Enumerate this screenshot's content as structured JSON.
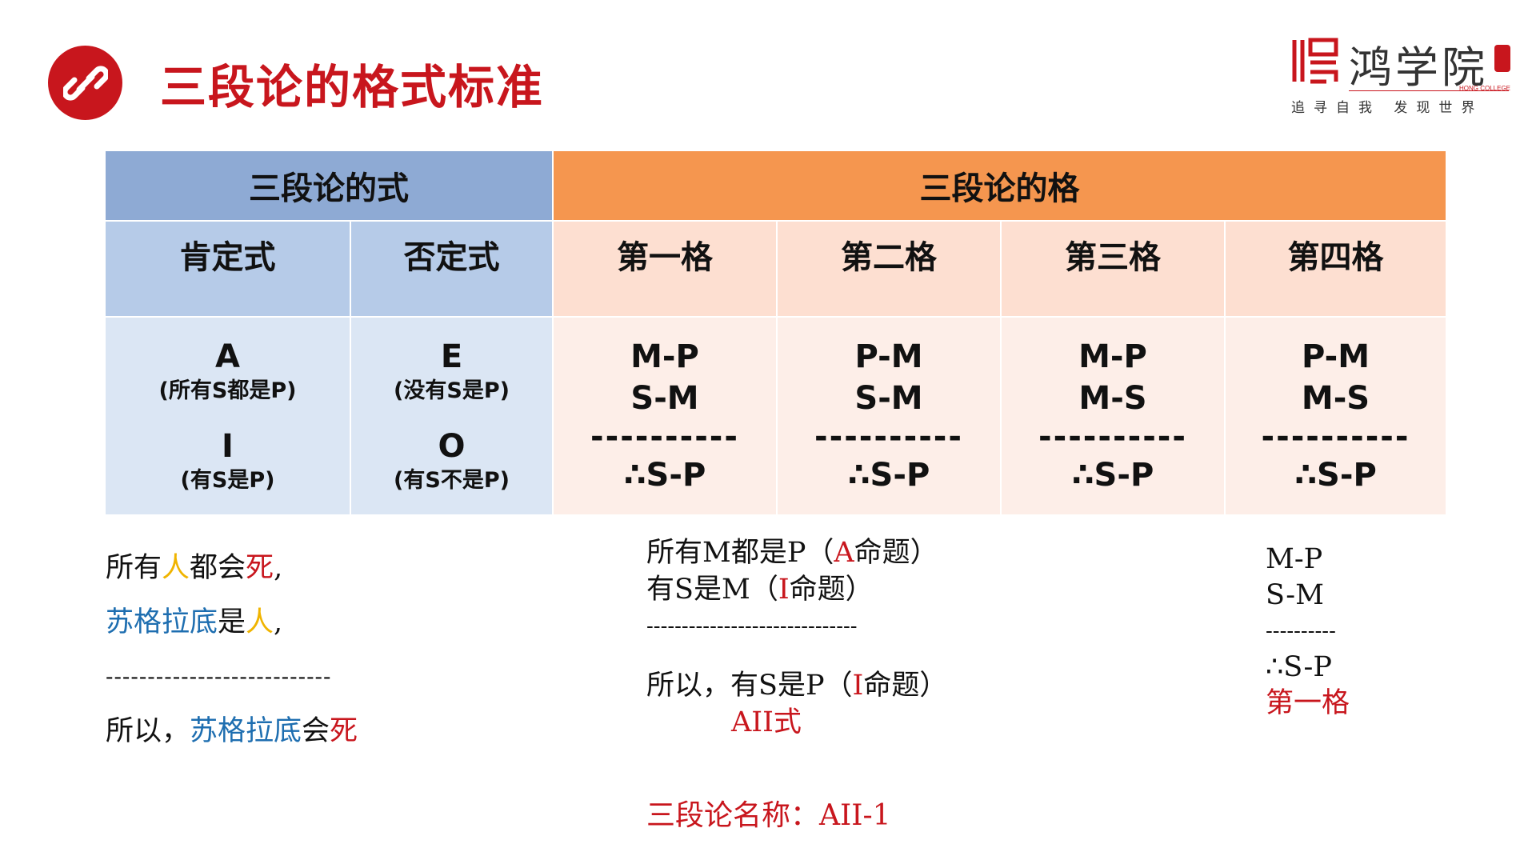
{
  "header": {
    "title": "三段论的格式标准",
    "icon": "link-icon",
    "accent_color": "#c8161d"
  },
  "logo": {
    "name": "鸿学院",
    "english": "HONG COLLEGE",
    "slogan": "追寻自我 发现世界"
  },
  "table": {
    "group_headers": [
      "三段论的式",
      "三段论的格"
    ],
    "sub_headers": [
      "肯定式",
      "否定式",
      "第一格",
      "第二格",
      "第三格",
      "第四格"
    ],
    "mood_cells": [
      {
        "top": "A",
        "top_note": "(所有S都是P)",
        "bottom": "I",
        "bottom_note": "(有S是P)"
      },
      {
        "top": "E",
        "top_note": "(没有S是P)",
        "bottom": "O",
        "bottom_note": "(有S不是P)"
      }
    ],
    "figure_cells": [
      {
        "major": "M-P",
        "minor": "S-M",
        "divider": "----------",
        "conclusion": "∴S-P"
      },
      {
        "major": "P-M",
        "minor": "S-M",
        "divider": "----------",
        "conclusion": "∴S-P"
      },
      {
        "major": "M-P",
        "minor": "M-S",
        "divider": "----------",
        "conclusion": "∴S-P"
      },
      {
        "major": "P-M",
        "minor": "M-S",
        "divider": "----------",
        "conclusion": "∴S-P"
      }
    ],
    "colors": {
      "blue_header": "#8eaad4",
      "orange_header": "#f5964f",
      "blue_sub": "#b6cbe8",
      "orange_sub": "#fddfd1",
      "blue_body": "#dbe6f4",
      "orange_body": "#fdeee8"
    }
  },
  "example": {
    "line1": [
      "所有",
      "人",
      "都会",
      "死",
      ","
    ],
    "line2": [
      "苏格拉底",
      "是",
      "人",
      ","
    ],
    "divider": "---------------------------",
    "line3": [
      "所以，",
      "苏格拉底",
      "会",
      "死"
    ]
  },
  "analysis": {
    "major_pre": "所有M都是P（",
    "major_letter": "A",
    "major_post": "命题）",
    "minor_pre": "有S是M（",
    "minor_letter": "I",
    "minor_post": "命题）",
    "divider": "------------------------------",
    "conclusion_pre": "所以，有S是P（",
    "conclusion_letter": "I",
    "conclusion_post": "命题）",
    "mood_label": "AII式"
  },
  "figure_example": {
    "major": "M-P",
    "minor": "S-M",
    "divider": "----------",
    "conclusion": "∴S-P",
    "label": "第一格"
  },
  "syllogism_name": "三段论名称：AII-1"
}
